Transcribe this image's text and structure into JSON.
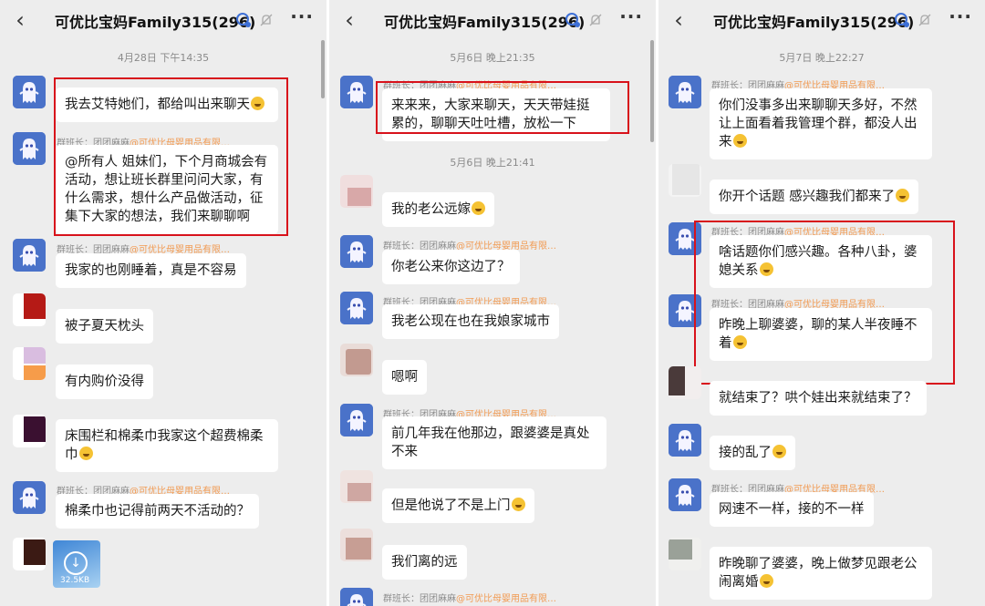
{
  "chat_title": "可优比宝妈Family315(296)",
  "panels": [
    {
      "timestamps": [
        "4月28日 下午14:35"
      ],
      "messages": [
        {
          "sender": "",
          "org": "",
          "text": "我去艾特她们，都给叫出来聊天"
        },
        {
          "sender": "群班长：团团麻麻",
          "org": "@可优比母婴用品有限…",
          "text": "@所有人  姐妹们，下个月商城会有活动，想让班长群里问问大家，有什么需求，想什么产品做活动，征集下大家的想法，我们来聊聊啊"
        },
        {
          "sender": "群班长：团团麻麻",
          "org": "@可优比母婴用品有限…",
          "text": "我家的也刚睡着，真是不容易"
        },
        {
          "sender": "",
          "org": "",
          "text": "被子夏天枕头"
        },
        {
          "sender": "",
          "org": "",
          "text": "有内购价没得"
        },
        {
          "sender": "",
          "org": "",
          "text": "床围栏和棉柔巾我家这个超费棉柔巾"
        },
        {
          "sender": "群班长：团团麻麻",
          "org": "@可优比母婴用品有限…",
          "text": "棉柔巾也记得前两天不活动的？"
        }
      ],
      "image_size": "32.5KB"
    },
    {
      "timestamps": [
        "5月6日 晚上21:35",
        "5月6日 晚上21:41"
      ],
      "messages": [
        {
          "sender": "群班长：团团麻麻",
          "org": "@可优比母婴用品有限…",
          "text": "来来来，大家来聊天，天天带娃挺累的，聊聊天吐吐槽，放松一下"
        },
        {
          "sender": "",
          "org": "",
          "text": "我的老公远嫁"
        },
        {
          "sender": "群班长：团团麻麻",
          "org": "@可优比母婴用品有限…",
          "text": "你老公来你这边了？"
        },
        {
          "sender": "群班长：团团麻麻",
          "org": "@可优比母婴用品有限…",
          "text": "我老公现在也在我娘家城市"
        },
        {
          "sender": "",
          "org": "",
          "text": "嗯啊"
        },
        {
          "sender": "群班长：团团麻麻",
          "org": "@可优比母婴用品有限…",
          "text": "前几年我在他那边，跟婆婆是真处不来"
        },
        {
          "sender": "",
          "org": "",
          "text": "但是他说了不是上门"
        },
        {
          "sender": "",
          "org": "",
          "text": "我们离的远"
        },
        {
          "sender": "群班长：团团麻麻",
          "org": "@可优比母婴用品有限…",
          "text": ""
        }
      ]
    },
    {
      "timestamps": [
        "5月7日 晚上22:27"
      ],
      "messages": [
        {
          "sender": "群班长：团团麻麻",
          "org": "@可优比母婴用品有限…",
          "text": "你们没事多出来聊聊天多好，不然让上面看着我管理个群，都没人出来"
        },
        {
          "sender": "",
          "org": "",
          "text": "你开个话题 感兴趣我们都来了"
        },
        {
          "sender": "群班长：团团麻麻",
          "org": "@可优比母婴用品有限…",
          "text": "啥话题你们感兴趣。各种八卦，婆媳关系"
        },
        {
          "sender": "群班长：团团麻麻",
          "org": "@可优比母婴用品有限…",
          "text": "昨晚上聊婆婆，聊的某人半夜睡不着"
        },
        {
          "sender": "",
          "org": "",
          "text": "就结束了？哄个娃出来就结束了？"
        },
        {
          "sender": "群班长：团团麻麻",
          "org": "@可优比母婴用品有限…",
          "text": "接的乱了"
        },
        {
          "sender": "群班长：团团麻麻",
          "org": "@可优比母婴用品有限…",
          "text": "网速不一样，接的不一样"
        },
        {
          "sender": "",
          "org": "",
          "text": "昨晚聊了婆婆，晚上做梦见跟老公闹离婚"
        }
      ]
    }
  ],
  "icons": {
    "back": "back-arrow-icon",
    "group": "group-chat-icon",
    "mute": "mute-bell-icon",
    "more": "more-options-icon",
    "emoji": "emoji-icon"
  },
  "colors": {
    "background": "#ededed",
    "bubble": "#ffffff",
    "highlight": "#d8121b",
    "org_tag": "#f19a52",
    "avatar": "#4a72c9"
  }
}
